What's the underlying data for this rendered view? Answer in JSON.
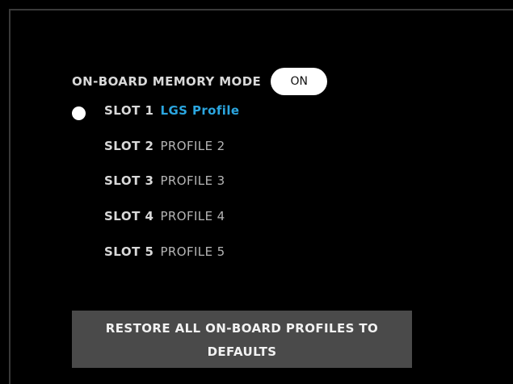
{
  "memory_mode": {
    "label": "ON-BOARD MEMORY MODE",
    "toggle_value": "ON"
  },
  "slots": [
    {
      "label": "SLOT 1",
      "profile": "LGS Profile",
      "active": true
    },
    {
      "label": "SLOT 2",
      "profile": "PROFILE 2",
      "active": false
    },
    {
      "label": "SLOT 3",
      "profile": "PROFILE 3",
      "active": false
    },
    {
      "label": "SLOT 4",
      "profile": "PROFILE 4",
      "active": false
    },
    {
      "label": "SLOT 5",
      "profile": "PROFILE 5",
      "active": false
    }
  ],
  "restore_button": {
    "label": "RESTORE ALL ON-BOARD PROFILES TO DEFAULTS"
  },
  "colors": {
    "background": "#000000",
    "active_profile": "#2ba6e0",
    "button_bg": "#4a4a4a",
    "toggle_bg": "#ffffff"
  }
}
